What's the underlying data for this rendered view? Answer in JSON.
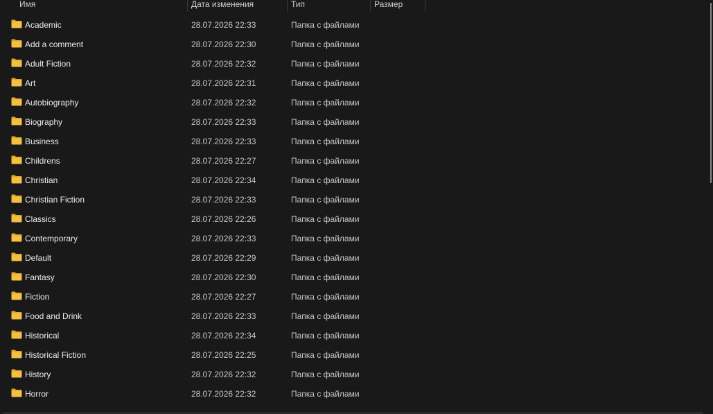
{
  "columns": {
    "name": "Имя",
    "date": "Дата изменения",
    "type": "Тип",
    "size": "Размер"
  },
  "icon": "folder-icon",
  "folder_color": "#f3c041",
  "folder_tab_color": "#e0a92c",
  "rows": [
    {
      "name": "Academic",
      "date": "28.07.2026 22:33",
      "type": "Папка с файлами",
      "size": ""
    },
    {
      "name": "Add a comment",
      "date": "28.07.2026 22:30",
      "type": "Папка с файлами",
      "size": ""
    },
    {
      "name": "Adult Fiction",
      "date": "28.07.2026 22:32",
      "type": "Папка с файлами",
      "size": ""
    },
    {
      "name": "Art",
      "date": "28.07.2026 22:31",
      "type": "Папка с файлами",
      "size": ""
    },
    {
      "name": "Autobiography",
      "date": "28.07.2026 22:32",
      "type": "Папка с файлами",
      "size": ""
    },
    {
      "name": "Biography",
      "date": "28.07.2026 22:33",
      "type": "Папка с файлами",
      "size": ""
    },
    {
      "name": "Business",
      "date": "28.07.2026 22:33",
      "type": "Папка с файлами",
      "size": ""
    },
    {
      "name": "Childrens",
      "date": "28.07.2026 22:27",
      "type": "Папка с файлами",
      "size": ""
    },
    {
      "name": "Christian",
      "date": "28.07.2026 22:34",
      "type": "Папка с файлами",
      "size": ""
    },
    {
      "name": "Christian Fiction",
      "date": "28.07.2026 22:33",
      "type": "Папка с файлами",
      "size": ""
    },
    {
      "name": "Classics",
      "date": "28.07.2026 22:26",
      "type": "Папка с файлами",
      "size": ""
    },
    {
      "name": "Contemporary",
      "date": "28.07.2026 22:33",
      "type": "Папка с файлами",
      "size": ""
    },
    {
      "name": "Default",
      "date": "28.07.2026 22:29",
      "type": "Папка с файлами",
      "size": ""
    },
    {
      "name": "Fantasy",
      "date": "28.07.2026 22:30",
      "type": "Папка с файлами",
      "size": ""
    },
    {
      "name": "Fiction",
      "date": "28.07.2026 22:27",
      "type": "Папка с файлами",
      "size": ""
    },
    {
      "name": "Food and Drink",
      "date": "28.07.2026 22:33",
      "type": "Папка с файлами",
      "size": ""
    },
    {
      "name": "Historical",
      "date": "28.07.2026 22:34",
      "type": "Папка с файлами",
      "size": ""
    },
    {
      "name": "Historical Fiction",
      "date": "28.07.2026 22:25",
      "type": "Папка с файлами",
      "size": ""
    },
    {
      "name": "History",
      "date": "28.07.2026 22:32",
      "type": "Папка с файлами",
      "size": ""
    },
    {
      "name": "Horror",
      "date": "28.07.2026 22:32",
      "type": "Папка с файлами",
      "size": ""
    }
  ]
}
